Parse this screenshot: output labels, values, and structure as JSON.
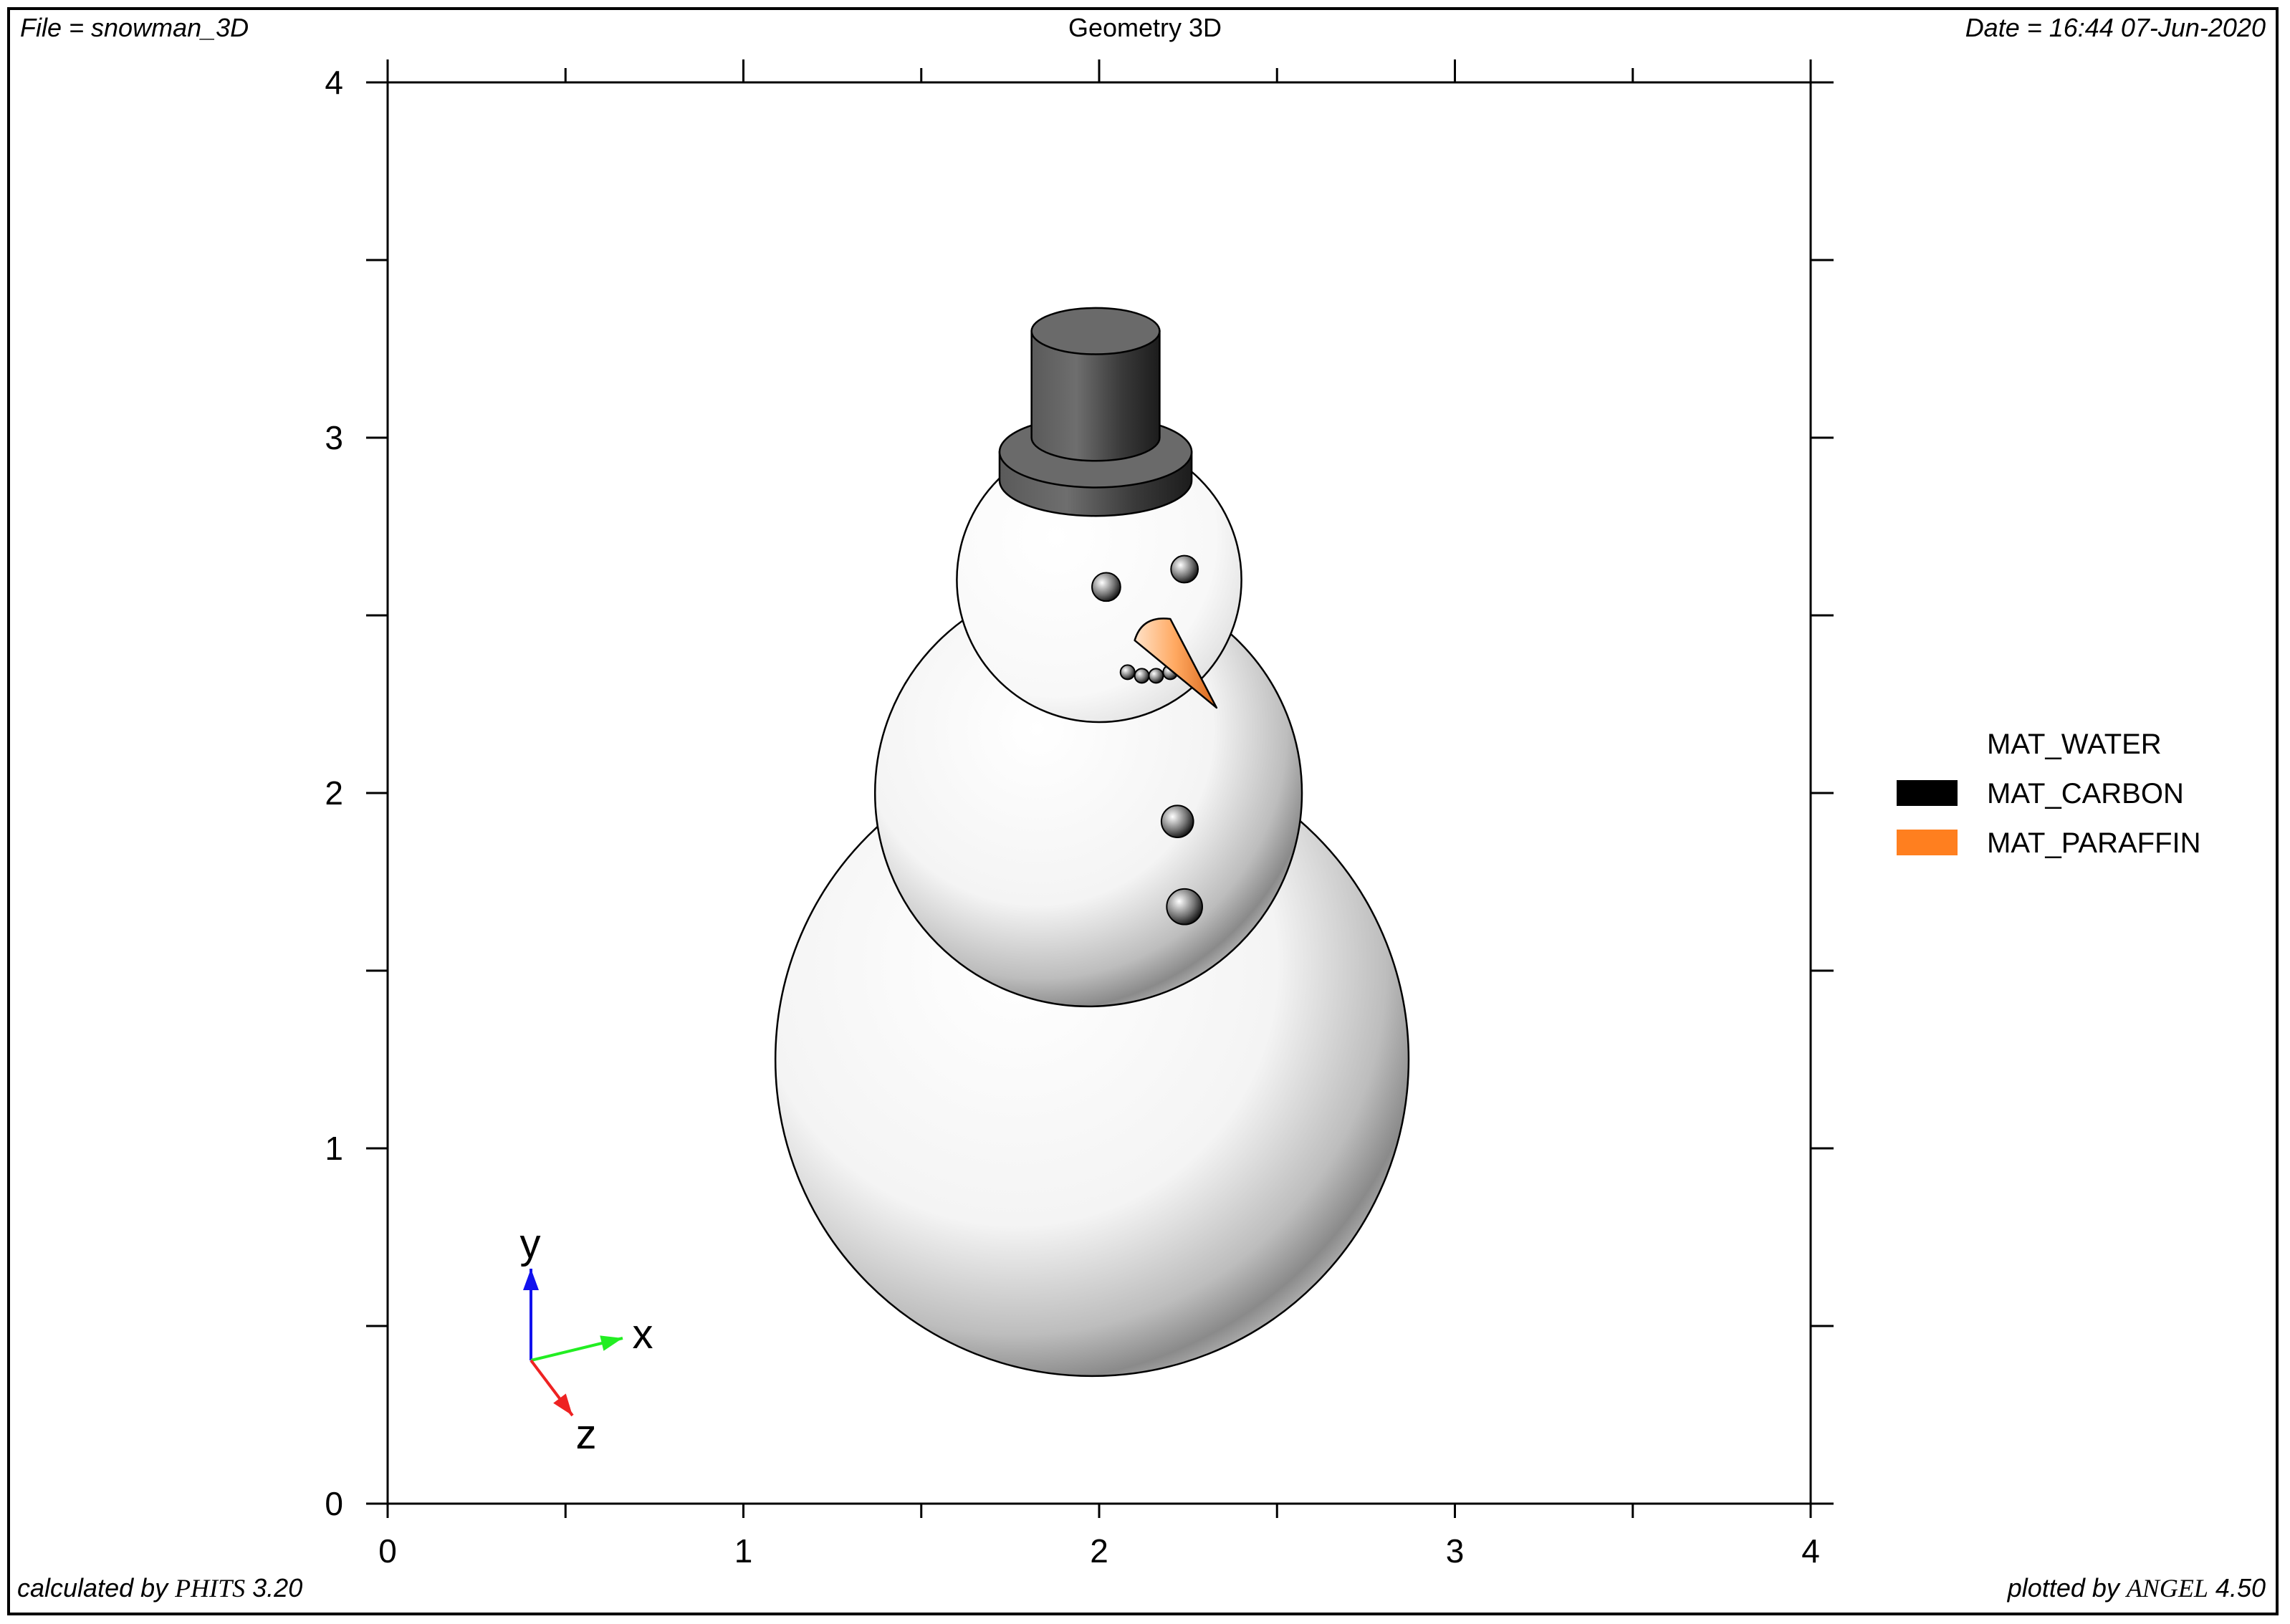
{
  "header": {
    "file": "File = snowman_3D",
    "title": "Geometry 3D",
    "date": "Date = 16:44 07-Jun-2020"
  },
  "footer": {
    "calculated_prefix": "calculated by ",
    "calculated_brand": "PHITS",
    "calculated_version": " 3.20",
    "plotted_prefix": "plotted by ",
    "plotted_brand": "ANGEL",
    "plotted_version": " 4.50"
  },
  "chart_data": {
    "type": "other",
    "xlim": [
      0,
      4
    ],
    "ylim": [
      0,
      4
    ],
    "x_ticks": [
      "0",
      "1",
      "2",
      "3",
      "4"
    ],
    "y_ticks": [
      "0",
      "1",
      "2",
      "3",
      "4"
    ],
    "grid": false,
    "legend_position": "right",
    "legend": [
      {
        "name": "MAT_WATER",
        "color": "#ffffff"
      },
      {
        "name": "MAT_CARBON",
        "color": "#000000"
      },
      {
        "name": "MAT_PARAFFIN",
        "color": "#ff7f1f"
      }
    ],
    "axis_indicator": {
      "x": "x",
      "y": "y",
      "z": "z",
      "colors": {
        "x": "#22ee22",
        "y": "#1111ee",
        "z": "#ee2222"
      }
    },
    "shapes": {
      "bottom_ball": {
        "cx": 1.98,
        "cy": 1.25,
        "r": 0.89
      },
      "middle_ball": {
        "cx": 1.97,
        "cy": 2.0,
        "r": 0.6
      },
      "head": {
        "cx": 2.0,
        "cy": 2.6,
        "r": 0.4
      },
      "hat_brim": {
        "cx": 1.99,
        "cy": 2.96,
        "rx": 0.27,
        "ry": 0.1,
        "h": 0.08
      },
      "hat_top": {
        "cx": 1.99,
        "cy": 3.3,
        "rx": 0.18,
        "ry": 0.065,
        "bottom": 3.0
      },
      "eyes": [
        {
          "x": 2.02,
          "y": 2.58,
          "r": 0.04
        },
        {
          "x": 2.24,
          "y": 2.63,
          "r": 0.038
        }
      ],
      "buttons": [
        {
          "x": 2.22,
          "y": 1.92,
          "r": 0.045
        },
        {
          "x": 2.24,
          "y": 1.68,
          "r": 0.05
        }
      ],
      "mouth": [
        {
          "x": 2.08,
          "y": 2.34
        },
        {
          "x": 2.12,
          "y": 2.33
        },
        {
          "x": 2.16,
          "y": 2.33
        },
        {
          "x": 2.2,
          "y": 2.34
        }
      ],
      "nose": {
        "base_a": [
          2.1,
          2.49
        ],
        "base_b": [
          2.2,
          2.49
        ],
        "tip": [
          2.33,
          2.24
        ]
      }
    }
  }
}
